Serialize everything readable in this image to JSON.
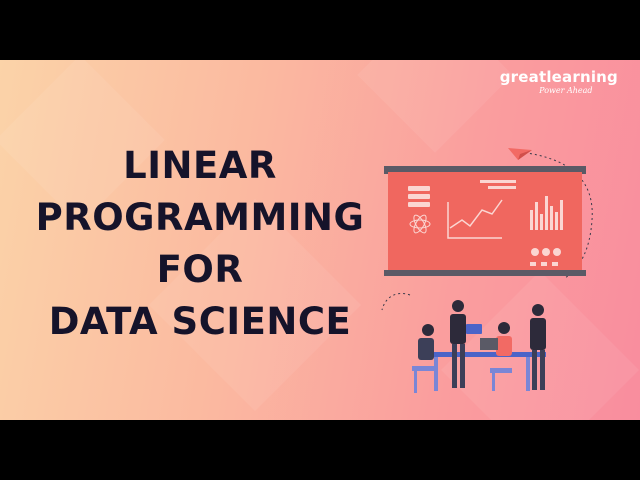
{
  "brand": {
    "name": "greatlearning",
    "tagline": "Power Ahead"
  },
  "title": {
    "lines": [
      "LINEAR",
      "PROGRAMMING",
      "FOR",
      "DATA SCIENCE"
    ]
  },
  "illustration": {
    "description_icon": "team-at-presentation-board-icon"
  },
  "colors": {
    "title": "#15132a",
    "board": "#f0675f",
    "board_frame": "#5a5a66",
    "bg_left": "#fbd3a8",
    "bg_right": "#f98d9e"
  }
}
